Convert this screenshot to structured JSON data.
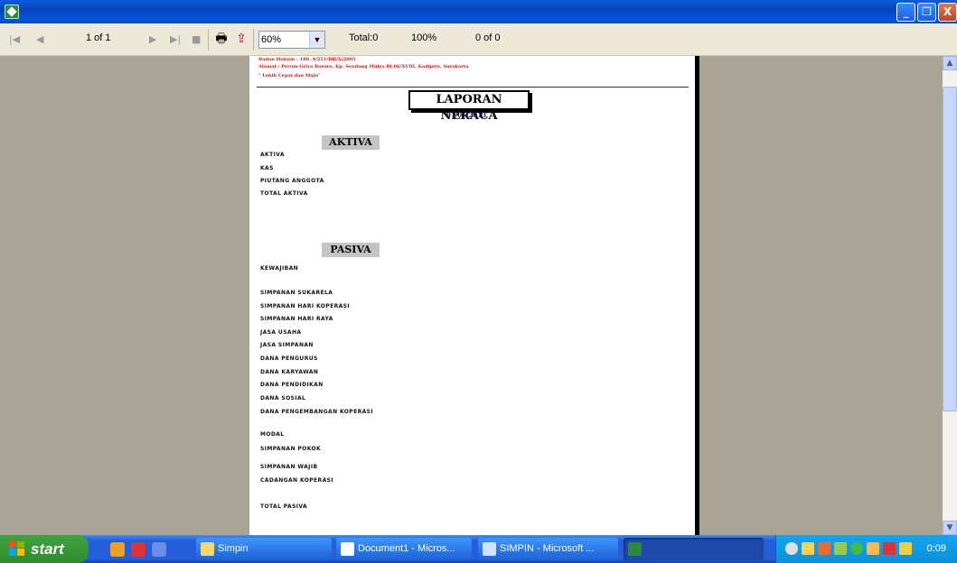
{
  "window": {
    "minimize": "_",
    "restore": "❐",
    "close": "X"
  },
  "toolbar": {
    "page_indicator": "1 of 1",
    "zoom_value": "60%",
    "total": "Total:0",
    "percent": "100%",
    "match": "0 of 0"
  },
  "report": {
    "header_lines": [
      "Badan Hukum : 188 .4/251/BH/X/2005",
      "Alamat : Perum Griya Bororo, Kp. Sendang Mulyo Rt.06/XVIII, Kadipiro, Surakarta",
      "\" Lebih Cepat dan Maju\""
    ],
    "title": "LAPORAN NERACA",
    "date": "01/01/2013",
    "aktiva_heading": "AKTIVA",
    "aktiva_items": [
      "AKTIVA",
      "KAS",
      "PIUTANG ANGGOTA",
      "TOTAL AKTIVA"
    ],
    "pasiva_heading": "PASIVA",
    "pasiva_items": [
      "KEWAJIBAN",
      "SIMPANAN SUKARELA",
      "SIMPANAN HARI KOPERASI",
      "SIMPANAN HARI RAYA",
      "JASA USAHA",
      "JASA SIMPANAN",
      "DANA PENGURUS",
      "DANA KARYAWAN",
      "DANA PENDIDIKAN",
      "DANA SOSIAL",
      "DANA PENGEMBANGAN KOPERASI",
      "MODAL",
      "SIMPANAN POKOK",
      "SIMPANAN WAJIB",
      "CADANGAN KOPERASI",
      "TOTAL PASIVA"
    ]
  },
  "taskbar": {
    "start": "start",
    "tasks": [
      "Simpin",
      "Document1 - Micros...",
      "SIMPIN - Microsoft ..."
    ],
    "clock": "0:09"
  },
  "icons": {
    "app": "app-icon",
    "first": "first-page-icon",
    "prev": "prev-page-icon",
    "next": "next-page-icon",
    "last": "last-page-icon",
    "stop": "stop-icon",
    "print": "printer-icon",
    "export": "export-icon"
  }
}
